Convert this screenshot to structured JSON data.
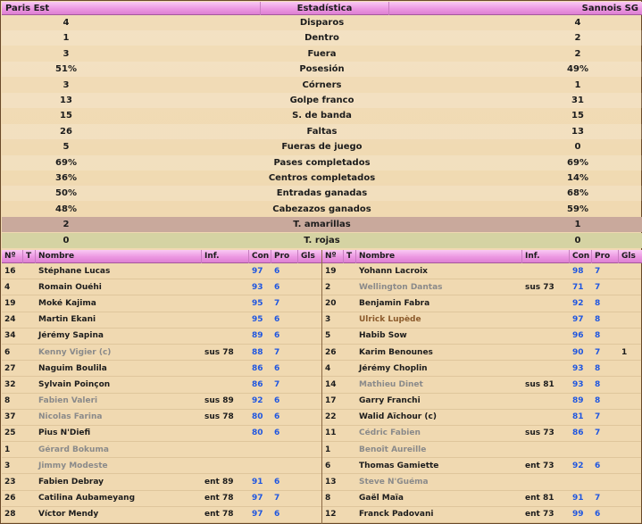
{
  "header": {
    "home": "Paris Est",
    "title": "Estadística",
    "away": "Sannois SG"
  },
  "stats": [
    {
      "h": "4",
      "label": "Disparos",
      "a": "4"
    },
    {
      "h": "1",
      "label": "Dentro",
      "a": "2"
    },
    {
      "h": "3",
      "label": "Fuera",
      "a": "2"
    },
    {
      "h": "51%",
      "label": "Posesión",
      "a": "49%"
    },
    {
      "h": "3",
      "label": "Córners",
      "a": "1"
    },
    {
      "h": "13",
      "label": "Golpe franco",
      "a": "31"
    },
    {
      "h": "15",
      "label": "S. de banda",
      "a": "15"
    },
    {
      "h": "26",
      "label": "Faltas",
      "a": "13"
    },
    {
      "h": "5",
      "label": "Fueras de juego",
      "a": "0"
    },
    {
      "h": "69%",
      "label": "Pases completados",
      "a": "69%"
    },
    {
      "h": "36%",
      "label": "Centros completados",
      "a": "14%"
    },
    {
      "h": "50%",
      "label": "Entradas ganadas",
      "a": "68%"
    },
    {
      "h": "48%",
      "label": "Cabezazos ganados",
      "a": "59%"
    },
    {
      "h": "2",
      "label": "T. amarillas",
      "a": "1"
    },
    {
      "h": "0",
      "label": "T. rojas",
      "a": "0"
    }
  ],
  "columns": {
    "no": "Nº",
    "t": "T",
    "name": "Nombre",
    "inf": "Inf.",
    "con": "Con",
    "pro": "Pro",
    "gls": "Gls"
  },
  "home_players": [
    {
      "no": "16",
      "t": "",
      "name": "Stéphane Lucas",
      "inf": "",
      "con": "97",
      "pro": "6",
      "gls": "",
      "sub": false
    },
    {
      "no": "4",
      "t": "",
      "name": "Romain Ouéhi",
      "inf": "",
      "con": "93",
      "pro": "6",
      "gls": "",
      "sub": false
    },
    {
      "no": "19",
      "t": "",
      "name": "Moké Kajima",
      "inf": "",
      "con": "95",
      "pro": "7",
      "gls": "",
      "sub": false
    },
    {
      "no": "24",
      "t": "",
      "name": "Martin Ekani",
      "inf": "",
      "con": "95",
      "pro": "6",
      "gls": "",
      "sub": false
    },
    {
      "no": "34",
      "t": "",
      "name": "Jérémy Sapina",
      "inf": "",
      "con": "89",
      "pro": "6",
      "gls": "",
      "sub": false
    },
    {
      "no": "6",
      "t": "yellow",
      "name": "Kenny Vigier (c)",
      "inf": "sus 78",
      "con": "88",
      "pro": "7",
      "gls": "",
      "sub": true
    },
    {
      "no": "27",
      "t": "yellow",
      "name": "Naguim Boulila",
      "inf": "",
      "con": "86",
      "pro": "6",
      "gls": "",
      "sub": false
    },
    {
      "no": "32",
      "t": "",
      "name": "Sylvain Poinçon",
      "inf": "",
      "con": "86",
      "pro": "7",
      "gls": "",
      "sub": false
    },
    {
      "no": "8",
      "t": "",
      "name": "Fabien Valeri",
      "inf": "sus 89",
      "con": "92",
      "pro": "6",
      "gls": "",
      "sub": true
    },
    {
      "no": "37",
      "t": "",
      "name": "Nicolas Farina",
      "inf": "sus 78",
      "con": "80",
      "pro": "6",
      "gls": "",
      "sub": true
    },
    {
      "no": "25",
      "t": "",
      "name": "Pius N'Diefi",
      "inf": "",
      "con": "80",
      "pro": "6",
      "gls": "",
      "sub": false
    },
    {
      "no": "1",
      "t": "",
      "name": "Gérard Bokuma",
      "inf": "",
      "con": "",
      "pro": "",
      "gls": "",
      "sub": true
    },
    {
      "no": "3",
      "t": "",
      "name": "Jimmy Modeste",
      "inf": "",
      "con": "",
      "pro": "",
      "gls": "",
      "sub": true
    },
    {
      "no": "23",
      "t": "",
      "name": "Fabien Debray",
      "inf": "ent 89",
      "con": "91",
      "pro": "6",
      "gls": "",
      "sub": false
    },
    {
      "no": "26",
      "t": "",
      "name": "Catilina Aubameyang",
      "inf": "ent 78",
      "con": "97",
      "pro": "7",
      "gls": "",
      "sub": false
    },
    {
      "no": "28",
      "t": "",
      "name": "Víctor Mendy",
      "inf": "ent 78",
      "con": "97",
      "pro": "6",
      "gls": "",
      "sub": false
    }
  ],
  "away_players": [
    {
      "no": "19",
      "t": "",
      "name": "Yohann Lacroix",
      "inf": "",
      "con": "98",
      "pro": "7",
      "gls": "",
      "sub": false
    },
    {
      "no": "2",
      "t": "yellow",
      "name": "Wellington Dantas",
      "inf": "sus 73",
      "con": "71",
      "pro": "7",
      "gls": "",
      "sub": true
    },
    {
      "no": "20",
      "t": "",
      "name": "Benjamin Fabra",
      "inf": "",
      "con": "92",
      "pro": "8",
      "gls": "",
      "sub": false
    },
    {
      "no": "3",
      "t": "star",
      "name": "Ulrick Lupède",
      "inf": "",
      "con": "97",
      "pro": "8",
      "gls": "",
      "sub": false,
      "star": true
    },
    {
      "no": "5",
      "t": "",
      "name": "Habib Sow",
      "inf": "",
      "con": "96",
      "pro": "8",
      "gls": "",
      "sub": false
    },
    {
      "no": "26",
      "t": "",
      "name": "Karim Benounes",
      "inf": "",
      "con": "90",
      "pro": "7",
      "gls": "1",
      "sub": false
    },
    {
      "no": "4",
      "t": "",
      "name": "Jérémy Choplin",
      "inf": "",
      "con": "93",
      "pro": "8",
      "gls": "",
      "sub": false
    },
    {
      "no": "14",
      "t": "",
      "name": "Mathieu Dinet",
      "inf": "sus 81",
      "con": "93",
      "pro": "8",
      "gls": "",
      "sub": true
    },
    {
      "no": "17",
      "t": "",
      "name": "Garry Franchi",
      "inf": "",
      "con": "89",
      "pro": "8",
      "gls": "",
      "sub": false
    },
    {
      "no": "22",
      "t": "",
      "name": "Walid Aïchour (c)",
      "inf": "",
      "con": "81",
      "pro": "7",
      "gls": "",
      "sub": false
    },
    {
      "no": "11",
      "t": "",
      "name": "Cédric Fabien",
      "inf": "sus 73",
      "con": "86",
      "pro": "7",
      "gls": "",
      "sub": true
    },
    {
      "no": "1",
      "t": "",
      "name": "Benoît Aureille",
      "inf": "",
      "con": "",
      "pro": "",
      "gls": "",
      "sub": true
    },
    {
      "no": "6",
      "t": "",
      "name": "Thomas Gamiette",
      "inf": "ent 73",
      "con": "92",
      "pro": "6",
      "gls": "",
      "sub": false
    },
    {
      "no": "13",
      "t": "",
      "name": "Steve N'Guéma",
      "inf": "",
      "con": "",
      "pro": "",
      "gls": "",
      "sub": true
    },
    {
      "no": "8",
      "t": "",
      "name": "Gaël Maïa",
      "inf": "ent 81",
      "con": "91",
      "pro": "7",
      "gls": "",
      "sub": false
    },
    {
      "no": "12",
      "t": "",
      "name": "Franck Padovani",
      "inf": "ent 73",
      "con": "99",
      "pro": "6",
      "gls": "",
      "sub": false
    }
  ],
  "colors": {
    "header": "#ec98e2",
    "link_values": "#1f56e0",
    "sub_name": "#8a8a8a",
    "star": "#8b5a2b"
  }
}
